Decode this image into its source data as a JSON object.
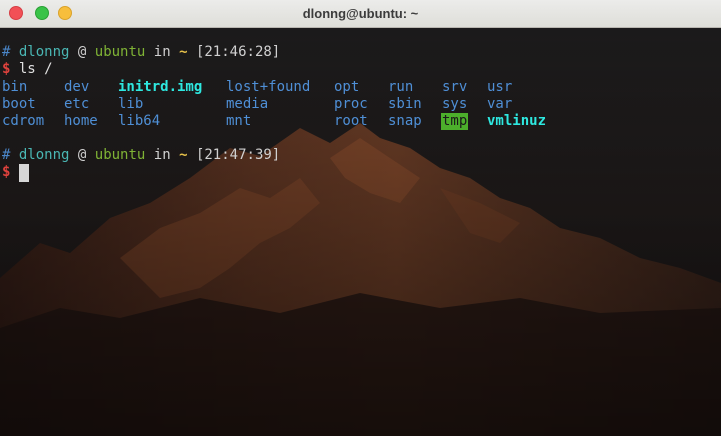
{
  "window": {
    "title": "dlonng@ubuntu: ~",
    "buttons": {
      "close": "close",
      "maximize": "maximize",
      "minimize": "minimize"
    }
  },
  "prompt1": {
    "hash": "#",
    "user": "dlonng",
    "at": "@",
    "host": "ubuntu",
    "in": "in",
    "dir": "~",
    "time": "[21:46:28]",
    "dollar": "$",
    "command": "ls /"
  },
  "listing": [
    [
      "bin",
      "dev",
      "initrd.img",
      "lost+found",
      "opt",
      "run",
      "srv",
      "usr"
    ],
    [
      "boot",
      "etc",
      "lib",
      "media",
      "proc",
      "sbin",
      "sys",
      "var"
    ],
    [
      "cdrom",
      "home",
      "lib64",
      "mnt",
      "root",
      "snap",
      "tmp",
      "vmlinuz"
    ]
  ],
  "prompt2": {
    "hash": "#",
    "user": "dlonng",
    "at": "@",
    "host": "ubuntu",
    "in": "in",
    "dir": "~",
    "time": "[21:47:39]",
    "dollar": "$",
    "command": ""
  },
  "colors": {
    "directory": "#4f8fd6",
    "symlink": "#2ee8e0",
    "sticky_bg": "#4caf2b",
    "prompt_dollar": "#e0423d"
  }
}
